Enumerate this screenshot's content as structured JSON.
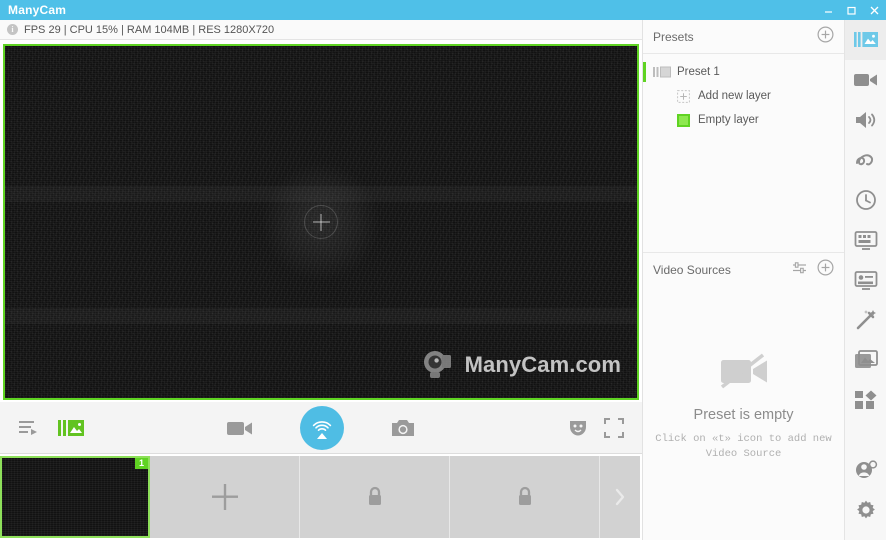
{
  "window": {
    "title": "ManyCam",
    "minimize_label": "Minimize",
    "maximize_label": "Maximize",
    "close_label": "Close"
  },
  "stats": {
    "text": "FPS 29 | CPU 15% | RAM 104MB | RES 1280X720",
    "fps": "FPS 29",
    "cpu": "CPU 15%",
    "ram": "RAM 104MB",
    "res": "RES 1280X720",
    "info_glyph": "i"
  },
  "video": {
    "watermark_text": "ManyCam.com",
    "border_color": "#5fd322",
    "add_source_glyph": "+"
  },
  "toolbar": {
    "playlist_label": "Playlist",
    "presets_label": "Presets",
    "record_label": "Record video",
    "broadcast_label": "Broadcast",
    "snapshot_label": "Snapshot",
    "masks_label": "Masks",
    "fullscreen_label": "Full screen",
    "broadcast_color": "#4fbde4"
  },
  "thumbnails": {
    "items": [
      {
        "label": "1",
        "state": "active"
      },
      {
        "label": "",
        "state": "add"
      },
      {
        "label": "",
        "state": "locked"
      },
      {
        "label": "",
        "state": "locked"
      }
    ],
    "scroll_next_label": "Next presets"
  },
  "presets_panel": {
    "title": "Presets",
    "add_label": "Add preset",
    "rows": [
      {
        "label": "Preset 1",
        "type": "preset"
      },
      {
        "label": "Add new layer",
        "type": "add-layer"
      },
      {
        "label": "Empty layer",
        "type": "layer"
      }
    ]
  },
  "video_sources_panel": {
    "title": "Video Sources",
    "settings_label": "Source settings",
    "add_label": "Add video source",
    "empty_title": "Preset is empty",
    "empty_hint": "Click on «t» icon to add new Video Source"
  },
  "rail": {
    "items": [
      {
        "name": "presets",
        "label": "Presets",
        "active": true
      },
      {
        "name": "video",
        "label": "Video sources",
        "active": false
      },
      {
        "name": "audio",
        "label": "Audio",
        "active": false
      },
      {
        "name": "draw",
        "label": "Draw",
        "active": false
      },
      {
        "name": "scheduler",
        "label": "Scheduler",
        "active": false
      },
      {
        "name": "chroma-key",
        "label": "Chroma key",
        "active": false
      },
      {
        "name": "lower-third",
        "label": "Lower thirds",
        "active": false
      },
      {
        "name": "effects",
        "label": "Effects",
        "active": false
      },
      {
        "name": "backgrounds",
        "label": "Backgrounds",
        "active": false
      },
      {
        "name": "objects",
        "label": "Objects",
        "active": false
      }
    ],
    "account_label": "Account",
    "settings_label": "Settings"
  },
  "colors": {
    "accent_blue": "#4fc0e8",
    "accent_green": "#5fd322",
    "panel_bg": "#fbfbfb",
    "toolbar_bg": "#f4f4f4"
  }
}
